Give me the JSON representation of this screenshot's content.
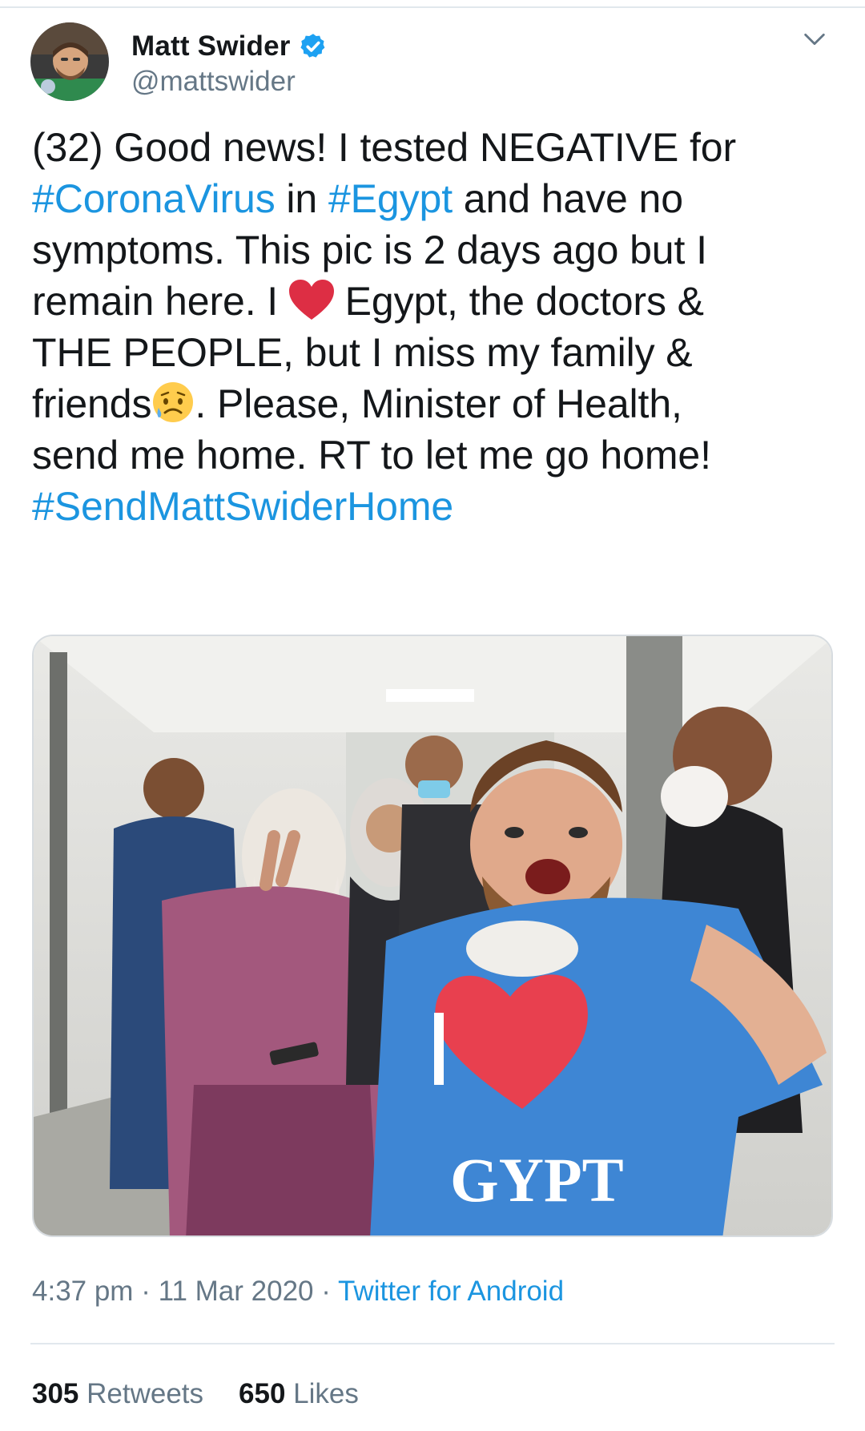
{
  "author": {
    "display_name": "Matt Swider",
    "handle": "@mattswider",
    "verified": true
  },
  "tweet": {
    "text_segments": [
      [
        "(32) Good news! I tested NEGATIVE for"
      ],
      [
        "#CoronaVirus",
        " in ",
        "#Egypt",
        " and have no"
      ],
      [
        "symptoms. This pic is 2 days ago but I"
      ],
      [
        "remain here. I ",
        "[red-heart-emoji]",
        " Egypt, the doctors &"
      ],
      [
        "THE PEOPLE, but I miss my family &"
      ],
      [
        "friends",
        "[sad-tear-emoji]",
        ". Please, Minister of Health,"
      ],
      [
        "send me home. RT to let me go home!"
      ],
      [
        "#SendMattSwiderHome"
      ]
    ],
    "line1": "(32) Good news! I tested NEGATIVE for",
    "hashtag_corona": "#CoronaVirus",
    "in_word": " in ",
    "hashtag_egypt": "#Egypt",
    "line2_rest": " and have no",
    "line3": "symptoms. This pic is 2 days ago but I",
    "line4_start": "remain here. I ",
    "line4_end": " Egypt, the doctors &",
    "line5": "THE PEOPLE, but I miss my family &",
    "line6_start": "friends",
    "line6_end": ". Please, Minister of Health,",
    "line7": "send me home. RT to let me go home!",
    "hashtag_home": "#SendMattSwiderHome",
    "shirt_text": "GYPT"
  },
  "meta": {
    "time": "4:37 pm",
    "separator": " · ",
    "date": "11 Mar 2020",
    "source": "Twitter for Android"
  },
  "stats": {
    "retweets_count": "305",
    "retweets_label": " Retweets",
    "likes_count": "650",
    "likes_label": " Likes"
  },
  "icons": {
    "verified": "verified-badge-icon",
    "menu": "chevron-down-icon",
    "heart": "red-heart-emoji",
    "sad": "sad-tear-emoji"
  },
  "colors": {
    "link": "#1b95e0",
    "secondary": "#657786",
    "verified": "#1da1f2",
    "heart": "#dd2e44"
  }
}
